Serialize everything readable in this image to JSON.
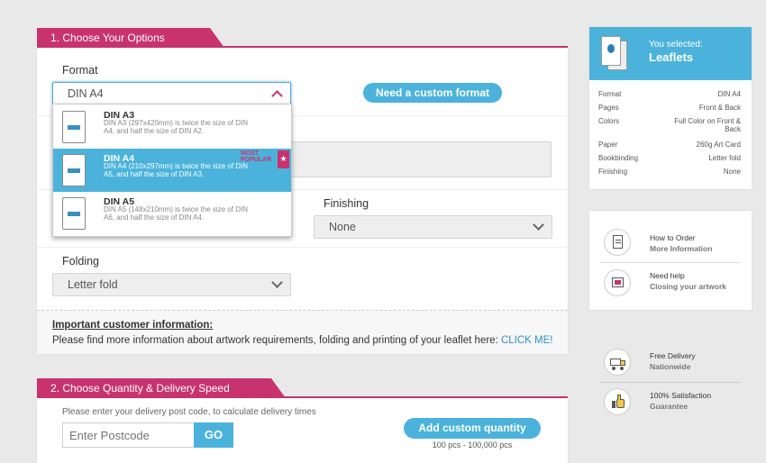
{
  "section1": {
    "title": "1. Choose Your Options",
    "format_label": "Format",
    "format_value": "DIN A4",
    "custom_format_button": "Need a custom format",
    "finishing_label": "Finishing",
    "finishing_value": "None",
    "folding_label": "Folding",
    "folding_value": "Letter fold",
    "info_heading": "Important customer information:",
    "info_text": "Please find more information about artwork requirements, folding and printing of your leaflet here:",
    "info_link": "CLICK ME!"
  },
  "dropdown": {
    "items": [
      {
        "title": "DIN A3",
        "desc": "DIN A3 (297x420mm) is twice the size of DIN A4, and half the size of DIN A2.",
        "icon_label": "DIN A3"
      },
      {
        "title": "DIN A4",
        "desc": "DIN A4 (210x297mm) is twice the size of DIN A5, and half the size of DIN A3.",
        "icon_label": "DIN A4"
      },
      {
        "title": "DIN A5",
        "desc": "DIN A5 (148x210mm) is twice the size of DIN A6, and half the size of DIN A4.",
        "icon_label": "DIN A5"
      }
    ],
    "popular_label": "MOST POPULAR",
    "badge_glyph": "★"
  },
  "section2": {
    "title": "2. Choose Quantity & Delivery Speed",
    "hint": "Please enter your delivery post code, to calculate delivery times",
    "postcode_placeholder": "Enter Postcode",
    "go_button": "GO",
    "custom_quantity_button": "Add custom quantity",
    "quantity_range": "100 pcs - 100,000 pcs"
  },
  "summary": {
    "header_small": "You selected:",
    "header_big": "Leaflets",
    "specs": [
      {
        "key": "Format",
        "value": "DIN A4"
      },
      {
        "key": "Pages",
        "value": "Front & Back"
      },
      {
        "key": "Colors",
        "value": "Full Color on Front & Back"
      },
      {
        "key": "Paper",
        "value": "260g Art Card"
      },
      {
        "key": "Bookbinding",
        "value": "Letter fold"
      },
      {
        "key": "Finishing",
        "value": "None"
      }
    ]
  },
  "help": {
    "items": [
      {
        "line1": "How to Order",
        "line2": "More Information",
        "icon": "clipboard-icon"
      },
      {
        "line1": "Need help",
        "line2": "Closing your artwork",
        "icon": "artwork-icon"
      }
    ]
  },
  "benefits": {
    "items": [
      {
        "line1": "Free Delivery",
        "line2": "Nationwide",
        "icon": "truck-icon"
      },
      {
        "line1": "100% Satisfaction",
        "line2": "Guarantee",
        "icon": "thumbs-up-icon"
      }
    ]
  },
  "colors": {
    "accent": "#c8336e",
    "primary": "#4bb3db"
  }
}
